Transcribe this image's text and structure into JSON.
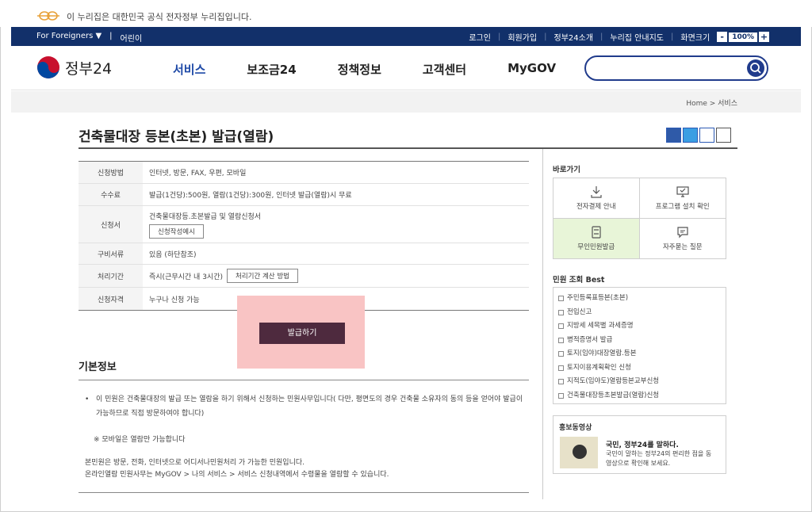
{
  "gov_banner": {
    "text": "이 누리집은 대한민국 공식 전자정부 누리집입니다."
  },
  "util": {
    "foreigners": "For Foreigners ▼",
    "kids": "어린이",
    "login": "로그인",
    "signup": "회원가입",
    "about": "정부24소개",
    "sitemap": "누리집 안내지도",
    "zoom_label": "화면크기",
    "zoom_minus": "-",
    "zoom_value": "100%",
    "zoom_plus": "+"
  },
  "header": {
    "logo": "정부24",
    "nav": [
      "서비스",
      "보조금24",
      "정책정보",
      "고객센터",
      "MyGOV"
    ],
    "search_placeholder": ""
  },
  "breadcrumb": "Home  >  서비스",
  "page": {
    "title": "건축물대장 등본(초본) 발급(열람)"
  },
  "info_table": {
    "rows": [
      {
        "label": "신청방법",
        "value": "인터넷, 방문, FAX, 우편, 모바일"
      },
      {
        "label": "수수료",
        "value": "발급(1건당):500원, 열람(1건당):300원, 인터넷 발급(열람)시 무료"
      },
      {
        "label": "신청서",
        "value": "건축물대장등.초본발급 및 열람신청서",
        "button": "신청작성예시"
      },
      {
        "label": "구비서류",
        "value": "있음 (하단참조)"
      },
      {
        "label": "처리기간",
        "value": "즉시(근무시간 내 3시간)",
        "button": "처리기간 계산 방법"
      },
      {
        "label": "신청자격",
        "value": "누구나 신청 가능"
      }
    ]
  },
  "issue_button": "발급하기",
  "basic_info": {
    "title": "기본정보",
    "bullet": "이 민원은 건축물대장의 발급 또는 열람을 하기 위해서 신청하는 민원사무입니다( 다만, 평면도의 경우 건축물 소유자의 동의 등을 얻어야 발급이 가능하므로 직접 방문하여야 합니다)",
    "note": "※ 모바일은 열람만 가능합니다",
    "para1": "본민원은 방문, 전화, 인터넷으로 어디서나민원처리 가 가능한 민원입니다.",
    "para2": "온라인열람 민원사무는 MyGOV > 나의 서비스 > 서비스 신청내역에서 수령물을 열람할 수 있습니다."
  },
  "sidebar": {
    "quick_title": "바로가기",
    "quick": [
      {
        "label": "전자결제 안내",
        "icon": "download-icon"
      },
      {
        "label": "프로그램 설치 확인",
        "icon": "monitor-check-icon"
      },
      {
        "label": "무인민원발급",
        "icon": "kiosk-icon"
      },
      {
        "label": "자주묻는 질문",
        "icon": "chat-icon"
      }
    ],
    "best_title": "민원 조회 Best",
    "best": [
      "주민등록표등본(초본)",
      "전입신고",
      "지방세 세목별 과세증명",
      "병적증명서 발급",
      "토지(임야)대장열람.등본",
      "토지이용계획확인 신청",
      "지적도(임야도)열람등본교부신청",
      "건축물대장등초본발급(열람)신청"
    ],
    "promo": {
      "title": "홍보동영상",
      "headline": "국민, 정부24를 말하다.",
      "desc": "국민이 말하는 정부24의 편리한 점을 동영상으로 확인해 보세요."
    }
  }
}
